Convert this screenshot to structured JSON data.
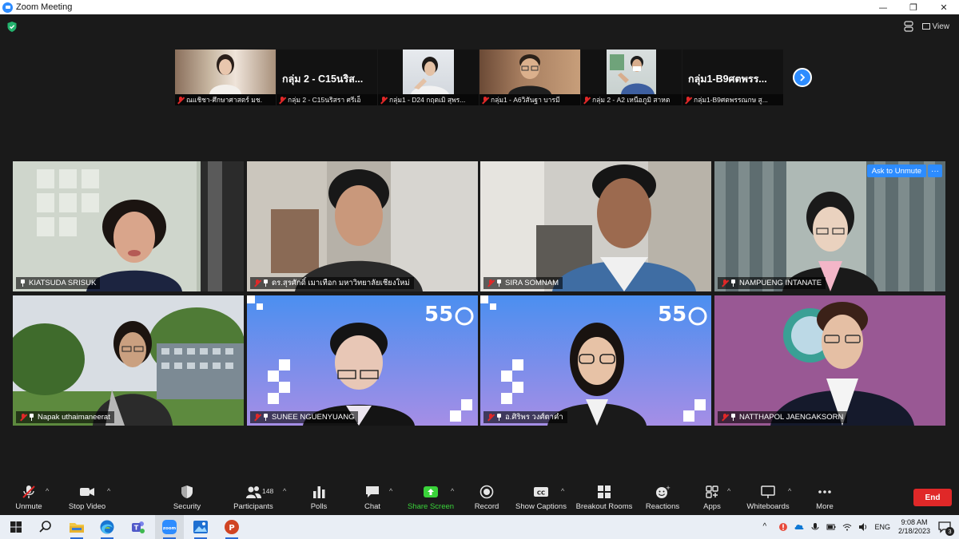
{
  "window": {
    "title": "Zoom Meeting",
    "controls": {
      "minimize": "—",
      "maximize": "❐",
      "close": "✕"
    }
  },
  "top_right": {
    "view_label": "View"
  },
  "strip": {
    "thumbs": [
      {
        "name": "ณแชิชา-ศึกษาศาสตร์ มช.",
        "big_name": ""
      },
      {
        "name": "กลุ่ม 2 - C15นริสรา  ศรีเอ็",
        "big_name": "กลุ่ม 2 - C15นริส..."
      },
      {
        "name": "กลุ่ม1 - D24 กฤตเมิ สุพร...",
        "big_name": ""
      },
      {
        "name": "กลุ่ม1 - A6วิสันฐา บารมี",
        "big_name": ""
      },
      {
        "name": "กลุ่ม 2 - A2 เหนือภูมิ สาหต",
        "big_name": ""
      },
      {
        "name": "กลุ่ม1-B9ศตพรรณกษ สู...",
        "big_name": "กลุ่ม1-B9ศตพรร..."
      }
    ]
  },
  "tiles": [
    {
      "name": "KIATSUDA SRISUK"
    },
    {
      "name": "ดร.สุรศักดิ์ เมาเทือก มหาวิทยาลัยเชียงใหม่"
    },
    {
      "name": "SIRA SOMNAM"
    },
    {
      "name": "NAMPUENG INTANATE",
      "ask_unmute": "Ask to Unmute",
      "more": "···"
    },
    {
      "name": "Napak uthaimaneerat"
    },
    {
      "name": "SUNEE NGUENYUANG"
    },
    {
      "name": "อ.ศิริพร วงศ์ตาคำ"
    },
    {
      "name": "NATTHAPOL JAENGAKSORN"
    }
  ],
  "toolbar": {
    "unmute": "Unmute",
    "stop_video": "Stop Video",
    "security": "Security",
    "participants": "Participants",
    "participants_count": "148",
    "polls": "Polls",
    "chat": "Chat",
    "share_screen": "Share Screen",
    "record": "Record",
    "captions": "Show Captions",
    "breakout": "Breakout Rooms",
    "reactions": "Reactions",
    "apps": "Apps",
    "whiteboards": "Whiteboards",
    "more": "More",
    "end": "End",
    "colors": {
      "end": "#e02828",
      "share": "#3ad33a",
      "accent": "#2d8cff",
      "active_speaker": "#c6e04d"
    }
  },
  "taskbar": {
    "lang": "ENG",
    "time": "9:08 AM",
    "date": "2/18/2023",
    "notification_count": "3"
  }
}
